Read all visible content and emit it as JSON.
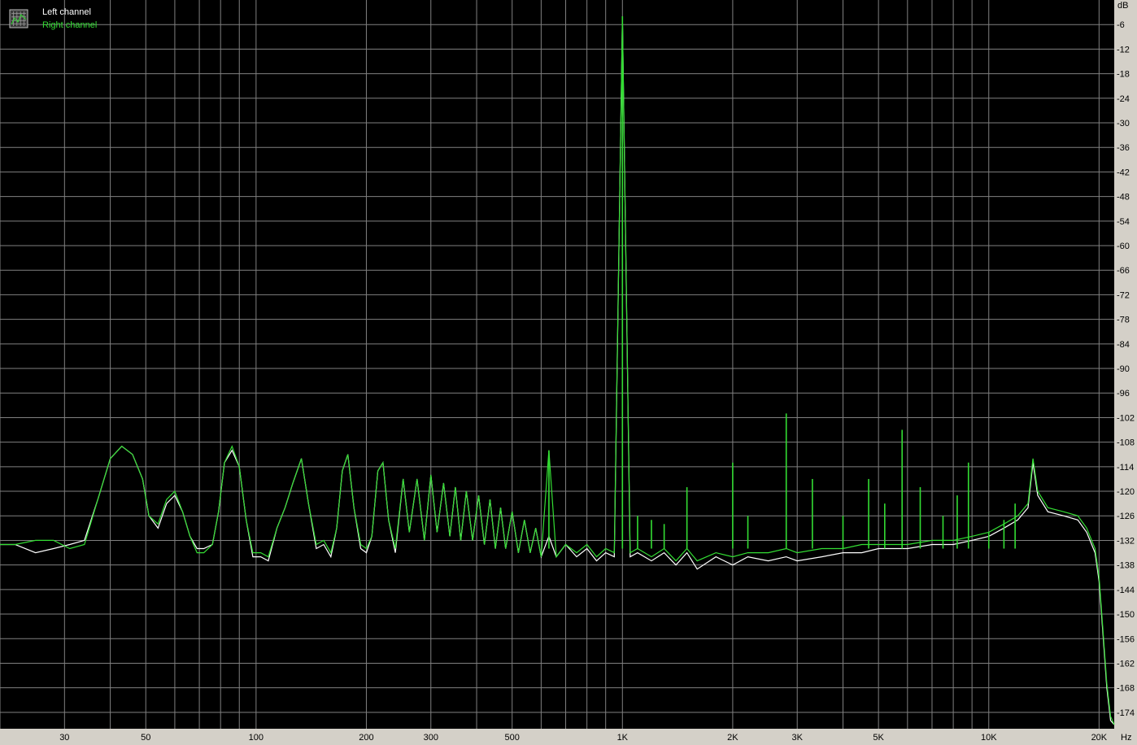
{
  "window": {
    "legend_icon": "grid-icon"
  },
  "chart_data": {
    "type": "line",
    "title": "",
    "xlabel": "",
    "ylabel": "",
    "x_unit": "Hz",
    "y_unit": "dB",
    "x_scale": "log",
    "xlim": [
      20,
      22000
    ],
    "ylim": [
      -178,
      0
    ],
    "grid": true,
    "legend_position": "top-left",
    "background": "#000000",
    "grid_color": "#808080",
    "x_ticks": [
      {
        "value": 30,
        "label": "30"
      },
      {
        "value": 50,
        "label": "50"
      },
      {
        "value": 100,
        "label": "100"
      },
      {
        "value": 200,
        "label": "200"
      },
      {
        "value": 300,
        "label": "300"
      },
      {
        "value": 500,
        "label": "500"
      },
      {
        "value": 1000,
        "label": "1K"
      },
      {
        "value": 2000,
        "label": "2K"
      },
      {
        "value": 3000,
        "label": "3K"
      },
      {
        "value": 5000,
        "label": "5K"
      },
      {
        "value": 10000,
        "label": "10K"
      },
      {
        "value": 20000,
        "label": "20K"
      }
    ],
    "y_ticks": [
      -6,
      -12,
      -18,
      -24,
      -30,
      -36,
      -42,
      -48,
      -54,
      -60,
      -66,
      -72,
      -78,
      -84,
      -90,
      -96,
      -102,
      -108,
      -114,
      -120,
      -126,
      -132,
      -138,
      -144,
      -150,
      -156,
      -162,
      -168,
      -174
    ],
    "series": [
      {
        "name": "Left channel",
        "color": "#ffffff",
        "points": [
          [
            20,
            -133
          ],
          [
            22,
            -133
          ],
          [
            25,
            -135
          ],
          [
            28,
            -134
          ],
          [
            31,
            -133
          ],
          [
            34,
            -132
          ],
          [
            37,
            -122
          ],
          [
            40,
            -112
          ],
          [
            43,
            -109
          ],
          [
            46,
            -111
          ],
          [
            49,
            -117
          ],
          [
            51,
            -126
          ],
          [
            54,
            -129
          ],
          [
            57,
            -123
          ],
          [
            60,
            -121
          ],
          [
            63,
            -125
          ],
          [
            66,
            -131
          ],
          [
            69,
            -134
          ],
          [
            72,
            -134
          ],
          [
            76,
            -133
          ],
          [
            79,
            -125
          ],
          [
            82,
            -113
          ],
          [
            86,
            -110
          ],
          [
            90,
            -114
          ],
          [
            94,
            -127
          ],
          [
            98,
            -136
          ],
          [
            103,
            -136
          ],
          [
            108,
            -137
          ],
          [
            114,
            -129
          ],
          [
            120,
            -124
          ],
          [
            126,
            -118
          ],
          [
            133,
            -112
          ],
          [
            139,
            -123
          ],
          [
            146,
            -134
          ],
          [
            153,
            -133
          ],
          [
            160,
            -136
          ],
          [
            166,
            -129
          ],
          [
            172,
            -115
          ],
          [
            178,
            -111
          ],
          [
            185,
            -124
          ],
          [
            193,
            -134
          ],
          [
            200,
            -135
          ],
          [
            207,
            -131
          ],
          [
            215,
            -115
          ],
          [
            222,
            -113
          ],
          [
            230,
            -127
          ],
          [
            240,
            -135
          ],
          [
            252,
            -117
          ],
          [
            262,
            -130
          ],
          [
            275,
            -117
          ],
          [
            288,
            -132
          ],
          [
            300,
            -116
          ],
          [
            312,
            -130
          ],
          [
            325,
            -118
          ],
          [
            338,
            -131
          ],
          [
            350,
            -119
          ],
          [
            362,
            -132
          ],
          [
            375,
            -120
          ],
          [
            390,
            -132
          ],
          [
            405,
            -121
          ],
          [
            420,
            -133
          ],
          [
            435,
            -122
          ],
          [
            450,
            -134
          ],
          [
            465,
            -124
          ],
          [
            480,
            -134
          ],
          [
            500,
            -125
          ],
          [
            520,
            -135
          ],
          [
            540,
            -127
          ],
          [
            560,
            -135
          ],
          [
            580,
            -129
          ],
          [
            600,
            -136
          ],
          [
            630,
            -131
          ],
          [
            660,
            -136
          ],
          [
            700,
            -133
          ],
          [
            750,
            -136
          ],
          [
            800,
            -134
          ],
          [
            850,
            -137
          ],
          [
            900,
            -135
          ],
          [
            950,
            -136
          ],
          [
            1000,
            -4
          ],
          [
            1050,
            -136
          ],
          [
            1100,
            -135
          ],
          [
            1200,
            -137
          ],
          [
            1300,
            -135
          ],
          [
            1400,
            -138
          ],
          [
            1500,
            -135
          ],
          [
            1600,
            -139
          ],
          [
            1800,
            -136
          ],
          [
            2000,
            -138
          ],
          [
            2200,
            -136
          ],
          [
            2500,
            -137
          ],
          [
            2800,
            -136
          ],
          [
            3000,
            -137
          ],
          [
            3500,
            -136
          ],
          [
            4000,
            -135
          ],
          [
            4500,
            -135
          ],
          [
            5000,
            -134
          ],
          [
            6000,
            -134
          ],
          [
            7000,
            -133
          ],
          [
            8000,
            -133
          ],
          [
            9000,
            -132
          ],
          [
            10000,
            -131
          ],
          [
            11000,
            -129
          ],
          [
            12000,
            -127
          ],
          [
            12800,
            -124
          ],
          [
            13200,
            -113
          ],
          [
            13600,
            -121
          ],
          [
            14500,
            -125
          ],
          [
            16000,
            -126
          ],
          [
            17500,
            -127
          ],
          [
            18500,
            -130
          ],
          [
            19500,
            -135
          ],
          [
            20000,
            -142
          ],
          [
            20500,
            -155
          ],
          [
            21000,
            -168
          ],
          [
            21500,
            -176
          ],
          [
            22000,
            -177
          ]
        ]
      },
      {
        "name": "Right channel",
        "color": "#33dd33",
        "points": [
          [
            20,
            -133
          ],
          [
            22,
            -133
          ],
          [
            25,
            -132
          ],
          [
            28,
            -132
          ],
          [
            31,
            -134
          ],
          [
            34,
            -133
          ],
          [
            37,
            -122
          ],
          [
            40,
            -112
          ],
          [
            43,
            -109
          ],
          [
            46,
            -111
          ],
          [
            49,
            -117
          ],
          [
            51,
            -126
          ],
          [
            54,
            -128
          ],
          [
            57,
            -122
          ],
          [
            60,
            -120
          ],
          [
            63,
            -125
          ],
          [
            66,
            -131
          ],
          [
            69,
            -135
          ],
          [
            72,
            -135
          ],
          [
            76,
            -133
          ],
          [
            79,
            -125
          ],
          [
            82,
            -113
          ],
          [
            86,
            -109
          ],
          [
            90,
            -114
          ],
          [
            94,
            -127
          ],
          [
            98,
            -135
          ],
          [
            103,
            -135
          ],
          [
            108,
            -136
          ],
          [
            114,
            -129
          ],
          [
            120,
            -124
          ],
          [
            126,
            -118
          ],
          [
            133,
            -112
          ],
          [
            139,
            -123
          ],
          [
            146,
            -133
          ],
          [
            153,
            -132
          ],
          [
            160,
            -135
          ],
          [
            166,
            -129
          ],
          [
            172,
            -115
          ],
          [
            178,
            -111
          ],
          [
            185,
            -124
          ],
          [
            193,
            -133
          ],
          [
            200,
            -134
          ],
          [
            207,
            -131
          ],
          [
            215,
            -115
          ],
          [
            222,
            -113
          ],
          [
            230,
            -127
          ],
          [
            240,
            -134
          ],
          [
            252,
            -117
          ],
          [
            262,
            -130
          ],
          [
            275,
            -117
          ],
          [
            288,
            -132
          ],
          [
            300,
            -116
          ],
          [
            312,
            -130
          ],
          [
            325,
            -118
          ],
          [
            338,
            -131
          ],
          [
            350,
            -119
          ],
          [
            362,
            -132
          ],
          [
            375,
            -120
          ],
          [
            390,
            -132
          ],
          [
            405,
            -121
          ],
          [
            420,
            -133
          ],
          [
            435,
            -122
          ],
          [
            450,
            -134
          ],
          [
            465,
            -124
          ],
          [
            480,
            -134
          ],
          [
            500,
            -125
          ],
          [
            520,
            -135
          ],
          [
            540,
            -127
          ],
          [
            560,
            -135
          ],
          [
            580,
            -129
          ],
          [
            600,
            -136
          ],
          [
            630,
            -110
          ],
          [
            660,
            -136
          ],
          [
            700,
            -133
          ],
          [
            750,
            -135
          ],
          [
            800,
            -133
          ],
          [
            850,
            -136
          ],
          [
            900,
            -134
          ],
          [
            950,
            -135
          ],
          [
            1000,
            -4
          ],
          [
            1050,
            -135
          ],
          [
            1100,
            -134
          ],
          [
            1200,
            -136
          ],
          [
            1300,
            -134
          ],
          [
            1400,
            -137
          ],
          [
            1500,
            -134
          ],
          [
            1600,
            -137
          ],
          [
            1800,
            -135
          ],
          [
            2000,
            -136
          ],
          [
            2200,
            -135
          ],
          [
            2500,
            -135
          ],
          [
            2800,
            -134
          ],
          [
            3000,
            -135
          ],
          [
            3500,
            -134
          ],
          [
            4000,
            -134
          ],
          [
            4500,
            -133
          ],
          [
            5000,
            -133
          ],
          [
            6000,
            -133
          ],
          [
            7000,
            -132
          ],
          [
            8000,
            -132
          ],
          [
            9000,
            -131
          ],
          [
            10000,
            -130
          ],
          [
            11000,
            -128
          ],
          [
            12000,
            -126
          ],
          [
            12800,
            -123
          ],
          [
            13200,
            -112
          ],
          [
            13600,
            -120
          ],
          [
            14500,
            -124
          ],
          [
            16000,
            -125
          ],
          [
            17500,
            -126
          ],
          [
            18500,
            -129
          ],
          [
            19500,
            -134
          ],
          [
            20000,
            -141
          ],
          [
            20500,
            -154
          ],
          [
            21000,
            -167
          ],
          [
            21500,
            -175
          ],
          [
            22000,
            -177
          ]
        ]
      }
    ],
    "spikes": [
      {
        "freq": 630,
        "db": -110
      },
      {
        "freq": 1000,
        "db": -4
      },
      {
        "freq": 1100,
        "db": -126
      },
      {
        "freq": 1200,
        "db": -127
      },
      {
        "freq": 1300,
        "db": -128
      },
      {
        "freq": 1500,
        "db": -119
      },
      {
        "freq": 2000,
        "db": -113
      },
      {
        "freq": 2200,
        "db": -126
      },
      {
        "freq": 2800,
        "db": -101
      },
      {
        "freq": 3300,
        "db": -117
      },
      {
        "freq": 4000,
        "db": -126
      },
      {
        "freq": 4700,
        "db": -117
      },
      {
        "freq": 5200,
        "db": -123
      },
      {
        "freq": 5800,
        "db": -105
      },
      {
        "freq": 6500,
        "db": -119
      },
      {
        "freq": 7500,
        "db": -126
      },
      {
        "freq": 8200,
        "db": -121
      },
      {
        "freq": 8800,
        "db": -113
      },
      {
        "freq": 10000,
        "db": -130
      },
      {
        "freq": 11000,
        "db": -127
      },
      {
        "freq": 11800,
        "db": -123
      }
    ]
  }
}
